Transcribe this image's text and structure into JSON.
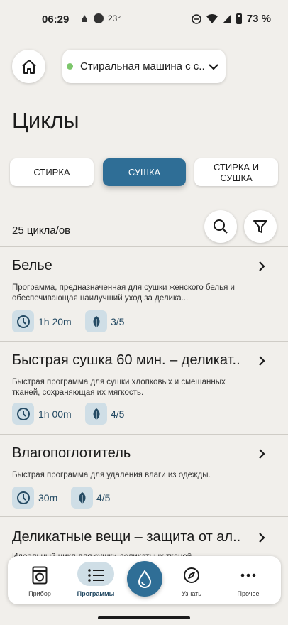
{
  "status_bar": {
    "time": "06:29",
    "temperature": "23°",
    "battery": "73 %"
  },
  "header": {
    "device_label": "Стиральная машина с с...",
    "status_color": "#7cc66b"
  },
  "page": {
    "title": "Циклы"
  },
  "tabs": [
    {
      "label": "СТИРКА",
      "active": false
    },
    {
      "label": "СУШКА",
      "active": true
    },
    {
      "label": "СТИРКА И СУШКА",
      "active": false
    }
  ],
  "list": {
    "count_label": "25 цикла/ов"
  },
  "cycles": [
    {
      "title": "Белье",
      "description": "Программа, предназначенная для сушки женского белья и обеспечивающая наилучший уход за делика...",
      "duration": "1h 20m",
      "care": "3/5"
    },
    {
      "title": "Быстрая сушка 60 мин. – деликат..",
      "description": "Быстрая программа для сушки хлопковых и смешанных тканей, сохраняющая их мягкость.",
      "duration": "1h 00m",
      "care": "4/5"
    },
    {
      "title": "Влагопоглотитель",
      "description": "Быстрая программа для удаления влаги из одежды.",
      "duration": "30m",
      "care": "4/5"
    },
    {
      "title": "Деликатные вещи – защита от ал..",
      "description": "Идеальный цикл для сушки деликатных тканей",
      "duration": "",
      "care": ""
    }
  ],
  "bottom_nav": {
    "items": [
      {
        "label": "Прибор",
        "icon": "appliance-icon",
        "active": false
      },
      {
        "label": "Программы",
        "icon": "list-icon",
        "active": true
      },
      {
        "label": "Узнать",
        "icon": "compass-icon",
        "active": false
      },
      {
        "label": "Прочее",
        "icon": "more-icon",
        "active": false
      }
    ],
    "fab_icon": "water-drop-icon"
  },
  "colors": {
    "accent": "#2f6e96",
    "chip_bg": "#cfdee6",
    "background": "#f1efeb"
  }
}
